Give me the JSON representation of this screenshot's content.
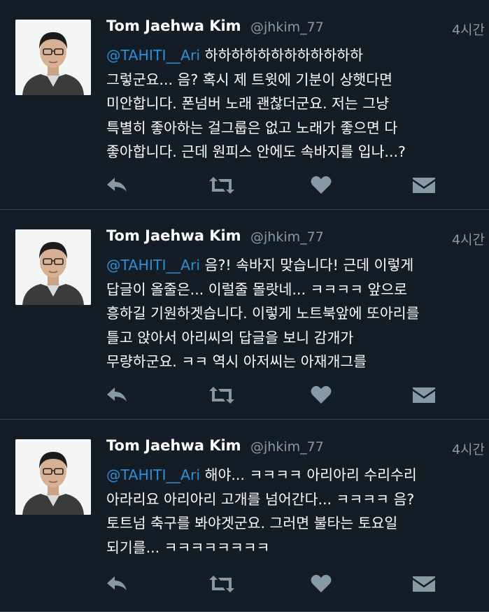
{
  "tweets": [
    {
      "author_name": "Tom Jaehwa Kim",
      "handle": "@jhkim_77",
      "time": "4시간",
      "mention": "@TAHITI__Ari",
      "lines": [
        " 하하하하하하하하하하하하",
        "그렇군요... 음? 혹시 제 트윗에 기분이 상햇다면",
        "미안합니다. 폰넘버 노래 괜찮더군요. 저는 그냥",
        "특별히 좋아하는 걸그룹은 없고 노래가 좋으면 다",
        "좋아합니다. 근데 원피스 안에도 속바지를 입나...?"
      ]
    },
    {
      "author_name": "Tom Jaehwa Kim",
      "handle": "@jhkim_77",
      "time": "4시간",
      "mention": "@TAHITI__Ari",
      "lines": [
        " 음?! 속바지 맞습니다! 근데 이렇게",
        "답글이 올줄은... 이럴줄 몰랏네... ㅋㅋㅋㅋ 앞으로",
        "흥하길 기원하겟습니다. 이렇게 노트북앞에 또아리를",
        "틀고 앉아서 아리씨의 답글을 보니 감개가",
        "무량하군요. ㅋㅋ 역시 아저씨는 아재개그를"
      ]
    },
    {
      "author_name": "Tom Jaehwa Kim",
      "handle": "@jhkim_77",
      "time": "4시간",
      "mention": "@TAHITI__Ari",
      "lines": [
        " 해야... ㅋㅋㅋㅋ 아리아리 수리수리",
        "아라리요 아리아리 고개를 넘어간다... ㅋㅋㅋㅋ 음?",
        "토트넘 축구를 봐야겟군요. 그러면 불타는 토요일",
        "되기를... ㅋㅋㅋㅋㅋㅋㅋㅋ"
      ]
    }
  ],
  "icons": {
    "reply": "reply-icon",
    "retweet": "retweet-icon",
    "like": "heart-icon",
    "dm": "direct-message-icon"
  },
  "colors": {
    "background": "#141d26",
    "mention": "#2c8fd6",
    "secondary_text": "#8899a6",
    "action_icon": "#8899a6"
  }
}
